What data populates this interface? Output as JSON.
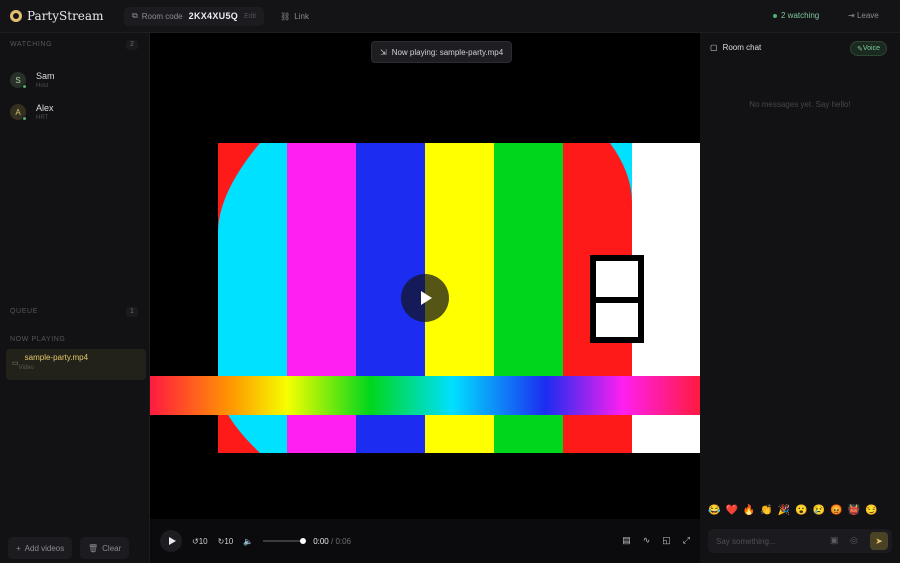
{
  "header": {
    "app_name": "PartyStream",
    "room_label": "Room code",
    "room_code": "2KX4XU5Q",
    "room_edit": "Edit",
    "link_label": "Link",
    "watching_label": "2 watching",
    "leave_label": "Leave"
  },
  "sidebar": {
    "watching_title": "WATCHING",
    "watching_count": "2",
    "users": [
      {
        "initial": "S",
        "name": "Sam",
        "status": "Host"
      },
      {
        "initial": "A",
        "name": "Alex",
        "status": "HRT"
      }
    ],
    "queue_title": "QUEUE",
    "queue_count": "1",
    "now_playing_title": "NOW PLAYING",
    "now_playing": {
      "title": "sample-party.mp4",
      "sub": "Video"
    },
    "add_videos_label": "Add videos",
    "clear_label": "Clear"
  },
  "player": {
    "now_playing_badge": "Now playing: sample-party.mp4",
    "skip_back": "10",
    "skip_forward": "10",
    "current_time": "0:00",
    "total_time": "0:06",
    "progress": 0
  },
  "chat": {
    "title": "Room chat",
    "voice_label": "Voice",
    "empty_text": "No messages yet. Say hello!",
    "emojis": [
      "😂",
      "❤️",
      "🔥",
      "👏",
      "🎉",
      "😮",
      "😢",
      "😡",
      "👹",
      "😏"
    ],
    "input_placeholder": "Say something..."
  },
  "colors": {
    "accent": "#e3c06b",
    "online": "#4caf6e"
  }
}
